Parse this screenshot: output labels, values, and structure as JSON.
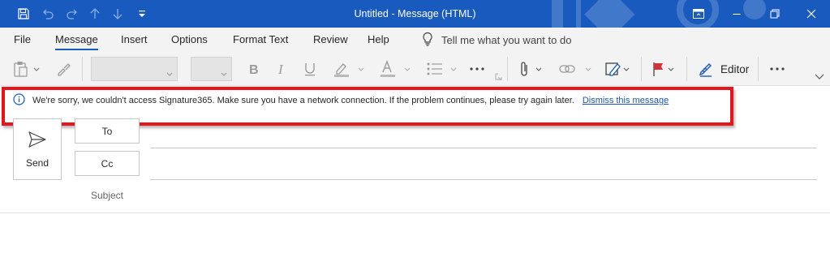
{
  "window": {
    "title": "Untitled  -  Message (HTML)",
    "accent": "#185abd"
  },
  "menu": {
    "tabs": [
      {
        "label": "File"
      },
      {
        "label": "Message",
        "active": true
      },
      {
        "label": "Insert"
      },
      {
        "label": "Options"
      },
      {
        "label": "Format Text"
      },
      {
        "label": "Review"
      },
      {
        "label": "Help"
      }
    ],
    "tell_me": "Tell me what you want to do"
  },
  "ribbon": {
    "editor_label": "Editor"
  },
  "message_bar": {
    "text": "We're sorry, we couldn't access Signature365. Make sure you have a network connection. If the problem continues, please try again later.",
    "dismiss_label": "Dismiss this message",
    "highlight_color": "#e8141a"
  },
  "compose": {
    "send_label": "Send",
    "to_label": "To",
    "cc_label": "Cc",
    "subject_label": "Subject"
  }
}
